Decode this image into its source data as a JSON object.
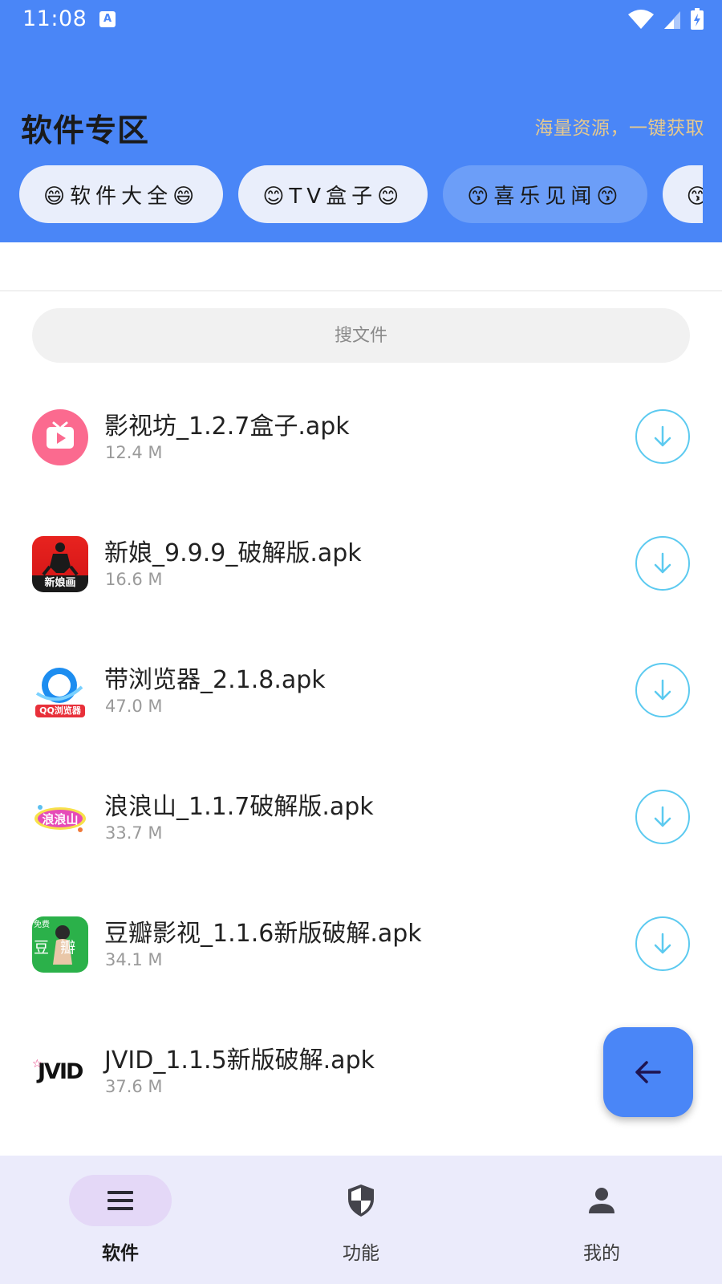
{
  "status_bar": {
    "time": "11:08",
    "app_indicator_label": "A"
  },
  "header": {
    "title": "软件专区",
    "subtitle": "海量资源，一键获取",
    "background_color": "#4a86f7",
    "subtitle_color": "#e6c98e"
  },
  "categories": [
    {
      "label": "😄软件大全😄",
      "active": false
    },
    {
      "label": "😊TV盒子😊",
      "active": false
    },
    {
      "label": "😙喜乐见闻😙",
      "active": true
    },
    {
      "label": "😙破",
      "active": false
    }
  ],
  "search": {
    "placeholder": "搜文件",
    "value": ""
  },
  "files": [
    {
      "name": "影视坊_1.2.7盒子.apk",
      "size": "12.4 M",
      "icon": "tv-play-icon"
    },
    {
      "name": "新娘_9.9.9_破解版.apk",
      "size": "16.6 M",
      "icon": "xinniang-logo-icon",
      "icon_text": "新娘画"
    },
    {
      "name": "带浏览器_2.1.8.apk",
      "size": "47.0 M",
      "icon": "qq-browser-icon",
      "icon_text": "QQ浏览器"
    },
    {
      "name": "浪浪山_1.1.7破解版.apk",
      "size": "33.7 M",
      "icon": "langlangshan-logo-icon",
      "icon_text": "浪浪山"
    },
    {
      "name": "豆瓣影视_1.1.6新版破解.apk",
      "size": "34.1 M",
      "icon": "douban-video-icon",
      "icon_text": "豆瓣",
      "icon_badge": "免费"
    },
    {
      "name": "JVID_1.1.5新版破解.apk",
      "size": "37.6 M",
      "icon": "jvid-logo-icon",
      "icon_text": "JVID"
    }
  ],
  "download_icon": "download-arrow-icon",
  "accent_color": "#5ccaf0",
  "fab": {
    "icon": "arrow-left-icon",
    "color": "#4a86f7"
  },
  "bottom_nav": [
    {
      "label": "软件",
      "icon": "menu-icon",
      "active": true
    },
    {
      "label": "功能",
      "icon": "shield-icon",
      "active": false
    },
    {
      "label": "我的",
      "icon": "person-icon",
      "active": false
    }
  ]
}
